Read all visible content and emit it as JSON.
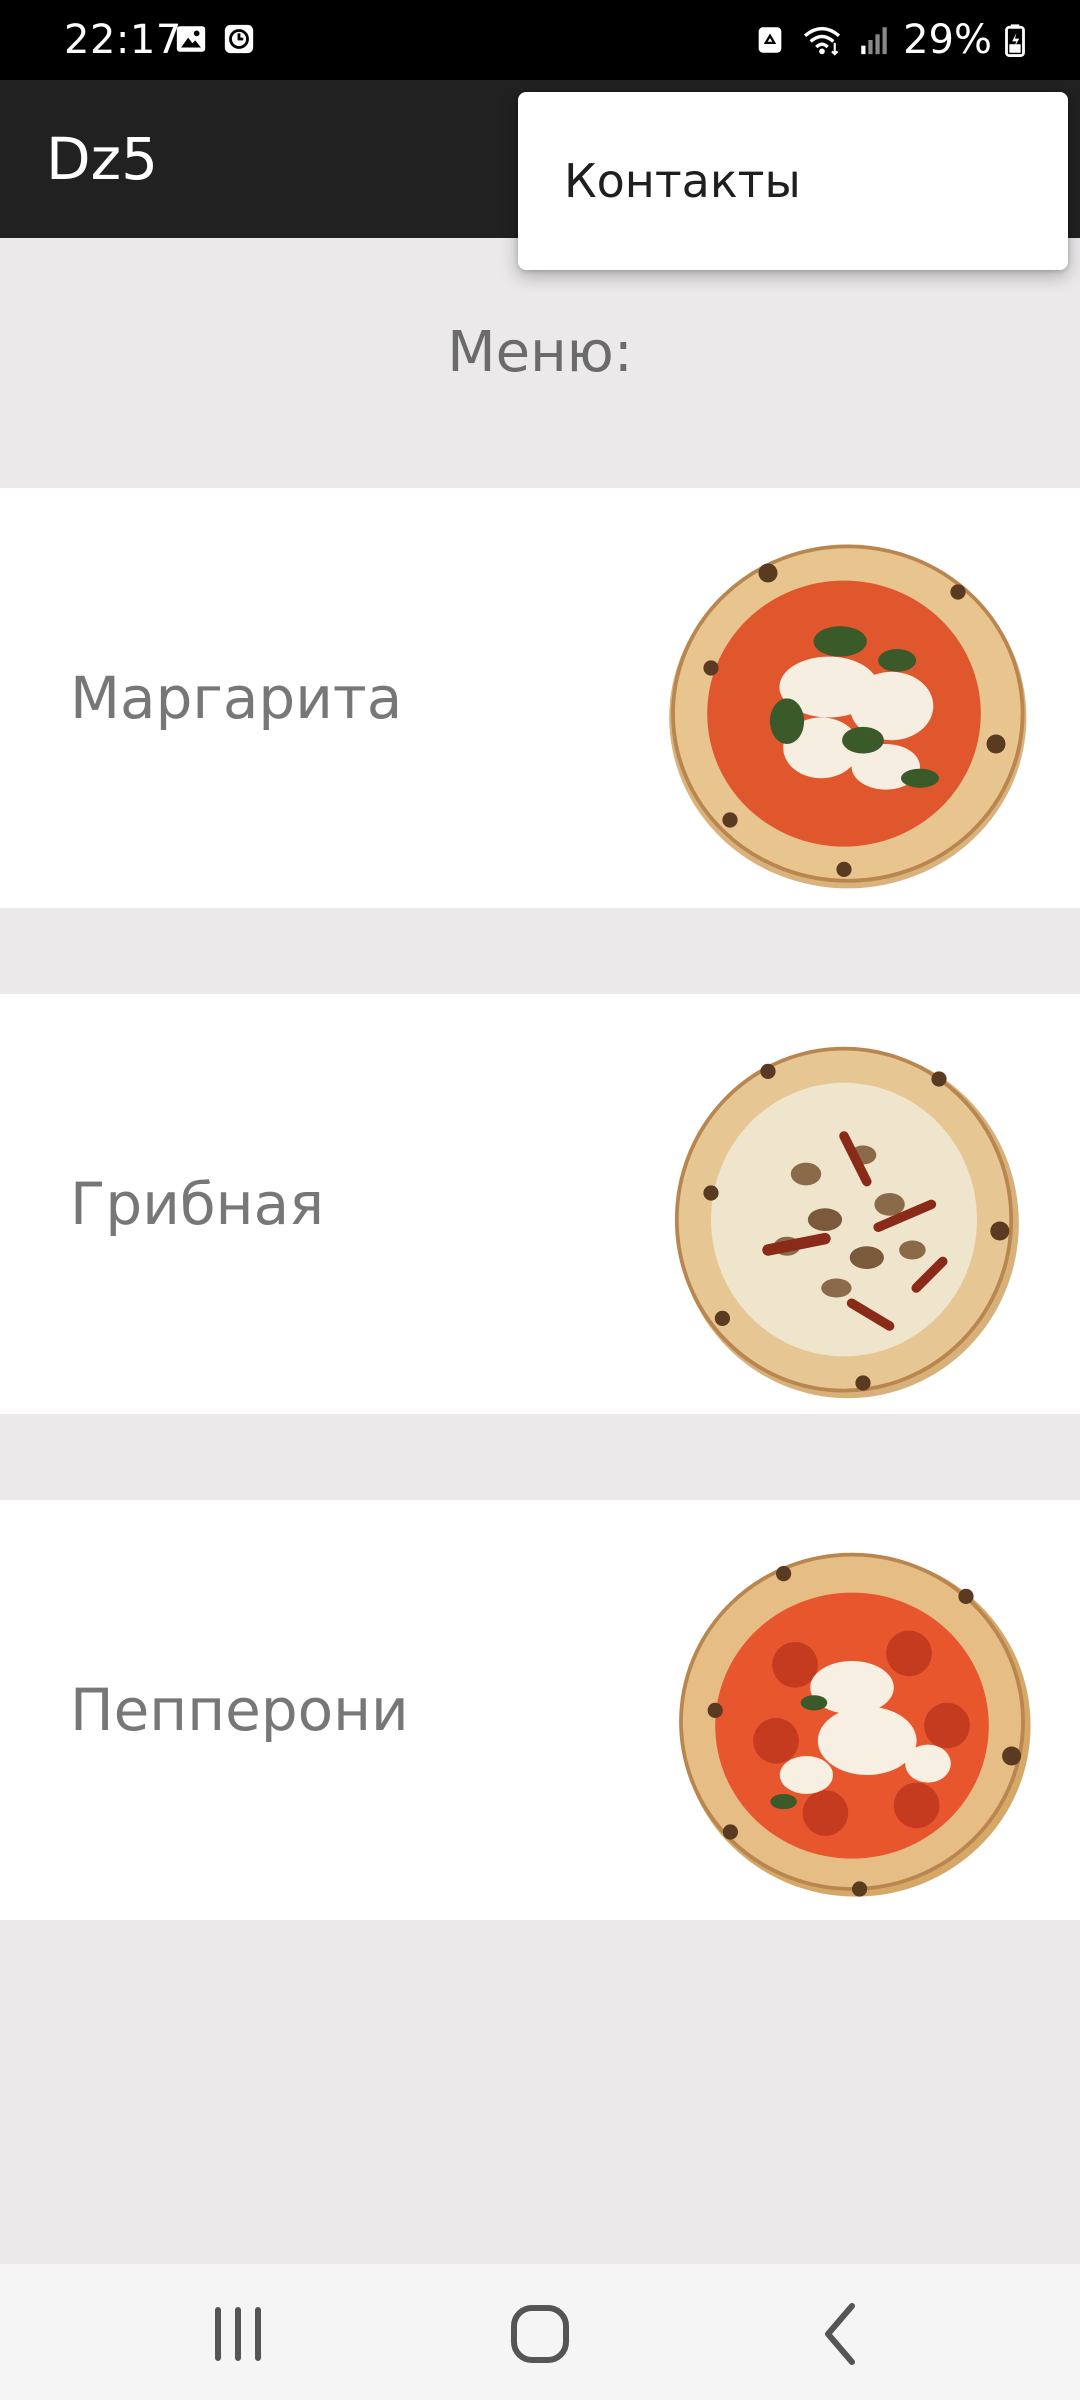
{
  "status_bar": {
    "time": "22:17",
    "battery": "29%",
    "icons": [
      "gallery-icon",
      "clock-icon",
      "recycle-icon",
      "wifi-icon",
      "signal-icon",
      "battery-icon"
    ]
  },
  "app_bar": {
    "title": "Dz5"
  },
  "overflow_menu": {
    "items": [
      {
        "label": "Контакты"
      }
    ]
  },
  "content": {
    "title": "Меню:",
    "items": [
      {
        "name": "Маргарита",
        "image": "margherita-pizza-image"
      },
      {
        "name": "Грибная",
        "image": "mushroom-pizza-image"
      },
      {
        "name": "Пепперони",
        "image": "pepperoni-pizza-image"
      }
    ]
  },
  "nav_bar": {
    "buttons": [
      "recent-apps-icon",
      "home-icon",
      "back-icon"
    ]
  },
  "colors": {
    "app_bar": "#212121",
    "background": "#ebe9ea",
    "card": "#ffffff",
    "text_secondary": "#777777",
    "nav_bar": "#f5f5f5"
  }
}
